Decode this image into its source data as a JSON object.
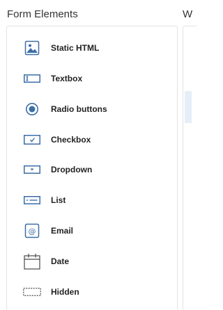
{
  "header": {
    "title": "Form Elements",
    "right_title": "W"
  },
  "items": [
    {
      "label": "Static HTML",
      "icon": "image-icon"
    },
    {
      "label": "Textbox",
      "icon": "textbox-icon"
    },
    {
      "label": "Radio buttons",
      "icon": "radio-icon"
    },
    {
      "label": "Checkbox",
      "icon": "checkbox-icon"
    },
    {
      "label": "Dropdown",
      "icon": "dropdown-icon"
    },
    {
      "label": "List",
      "icon": "list-icon"
    },
    {
      "label": "Email",
      "icon": "email-icon"
    },
    {
      "label": "Date",
      "icon": "calendar-icon"
    },
    {
      "label": "Hidden",
      "icon": "hidden-icon"
    }
  ],
  "colors": {
    "icon_blue": "#3c6ea8",
    "icon_dark": "#4a4a4a",
    "border": "#e3e3e3",
    "highlight": "#e6eef8"
  }
}
